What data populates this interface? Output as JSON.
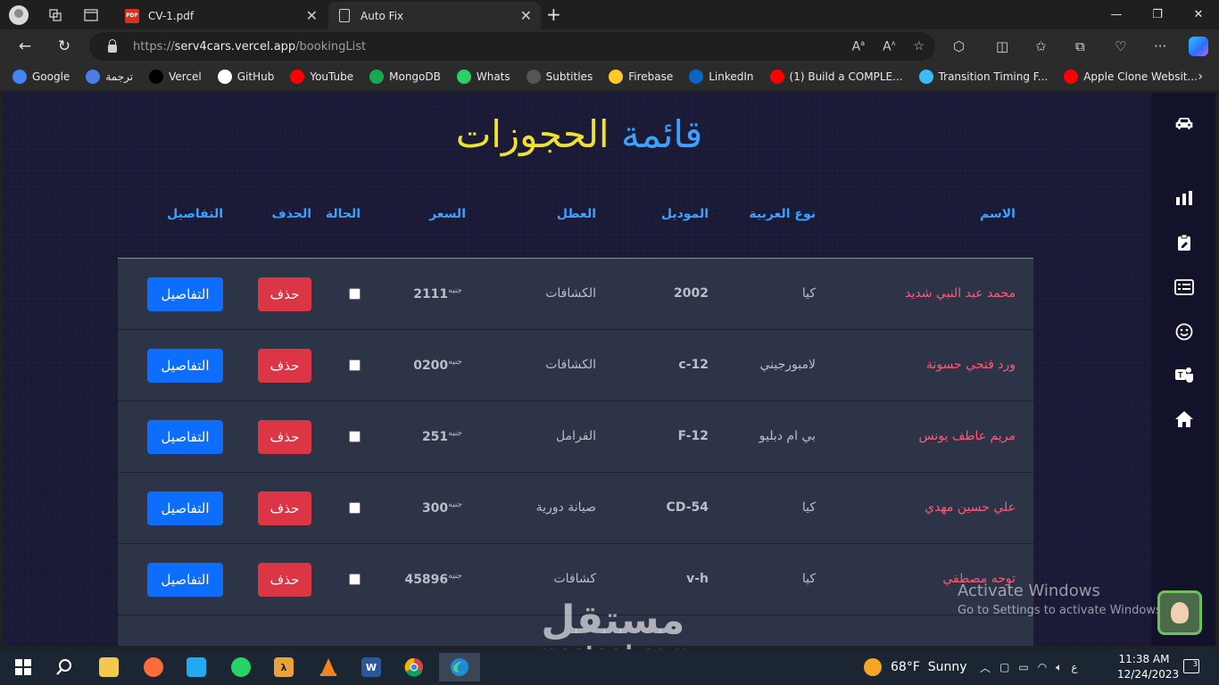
{
  "browser": {
    "tabs": [
      {
        "label": "CV-1.pdf",
        "icon": "pdf-icon",
        "active": false
      },
      {
        "label": "Auto Fix",
        "icon": "page-icon",
        "active": true
      }
    ],
    "pdf_badge": "PDF",
    "address": {
      "prefix": "https://",
      "host": "serv4cars.vercel.app",
      "path": "/bookingList"
    },
    "bookmarks": [
      {
        "label": "Google",
        "icon": "google-icon",
        "color": "#4285f4"
      },
      {
        "label": "ترجمة",
        "icon": "translate-icon",
        "color": "#4a7de8"
      },
      {
        "label": "Vercel",
        "icon": "vercel-icon",
        "color": "#000000"
      },
      {
        "label": "GitHub",
        "icon": "github-icon",
        "color": "#ffffff"
      },
      {
        "label": "YouTube",
        "icon": "youtube-icon",
        "color": "#ff0000"
      },
      {
        "label": "MongoDB",
        "icon": "mongodb-icon",
        "color": "#13aa52"
      },
      {
        "label": "Whats",
        "icon": "whatsapp-icon",
        "color": "#25d366"
      },
      {
        "label": "Subtitles",
        "icon": "subtitles-icon",
        "color": "#555555"
      },
      {
        "label": "Firebase",
        "icon": "firebase-icon",
        "color": "#ffca28"
      },
      {
        "label": "LinkedIn",
        "icon": "linkedin-icon",
        "color": "#0a66c2"
      },
      {
        "label": "(1) Build a COMPLE...",
        "icon": "youtube-icon",
        "color": "#ff0000"
      },
      {
        "label": "Transition Timing F...",
        "icon": "tailwind-icon",
        "color": "#38bdf8"
      },
      {
        "label": "Apple Clone Websit...",
        "icon": "youtube-icon",
        "color": "#ff0000"
      }
    ]
  },
  "page": {
    "title_word1": "قائمة",
    "title_word2": "الحجوزات",
    "headers": {
      "name": "الاسم",
      "car_type": "نوع العربية",
      "model": "الموديل",
      "fault": "العطل",
      "price": "السعر",
      "status": "الحالة",
      "delete": "الحذف",
      "details": "التفاصيل"
    },
    "currency": "جنيه",
    "delete_label": "حذف",
    "details_label": "التفاصيل",
    "rows": [
      {
        "name": "محمد عبد النبي شديد",
        "car_type": "كيا",
        "model": "2002",
        "fault": "الكشافات",
        "price": "2111"
      },
      {
        "name": "ورد فتحي حسونة",
        "car_type": "لامبورجيني",
        "model": "c-12",
        "fault": "الكشافات",
        "price": "0200"
      },
      {
        "name": "مريم عاطف يونس",
        "car_type": "بي ام دبليو",
        "model": "F-12",
        "fault": "الفرامل",
        "price": "251"
      },
      {
        "name": "علي حسين مهدي",
        "car_type": "كيا",
        "model": "CD-54",
        "fault": "صيانة دورية",
        "price": "300"
      },
      {
        "name": "توحه مصطفي",
        "car_type": "كيا",
        "model": "v-h",
        "fault": "كشافات",
        "price": "45896"
      }
    ],
    "colors": {
      "accent": "#3aa2ff",
      "title_yellow": "#f2e230",
      "name_red": "#ff5a74",
      "delete_red": "#dc3545",
      "details_blue": "#0d6efd"
    }
  },
  "overlay": {
    "activate_title": "Activate Windows",
    "activate_sub": "Go to Settings to activate Windows.",
    "watermark_ar": "مستقل",
    "watermark_en": "mostaql.com"
  },
  "taskbar": {
    "weather": {
      "temp": "68°F",
      "condition": "Sunny"
    },
    "lang": "ع",
    "time": "11:38 AM",
    "date": "12/24/2023",
    "notifications": "3"
  }
}
